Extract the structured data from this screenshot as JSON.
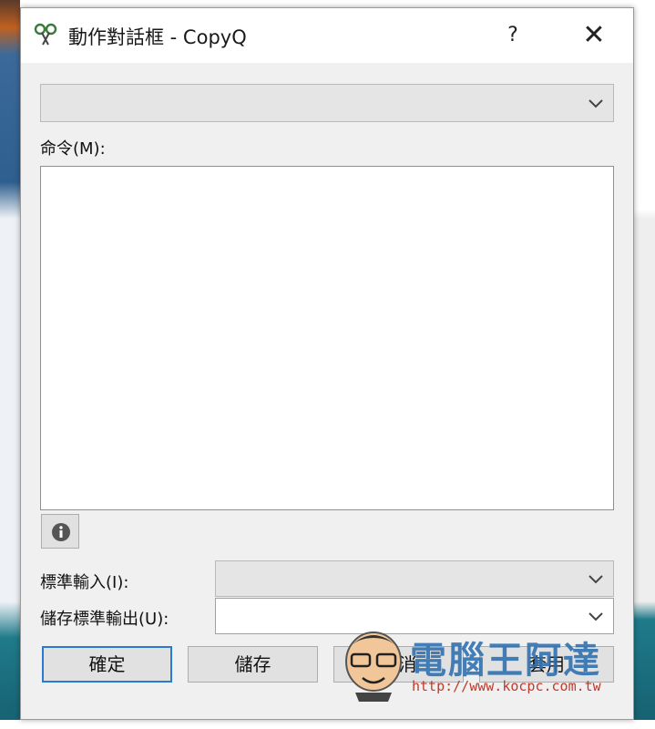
{
  "window": {
    "title": "動作對話框 - CopyQ",
    "help_label": "?",
    "close_label": "✕"
  },
  "action_combo": {
    "value": ""
  },
  "command": {
    "label": "命令(M):",
    "value": ""
  },
  "stdin": {
    "label": "標準輸入(I):",
    "value": ""
  },
  "stdout": {
    "label": "儲存標準輸出(U):",
    "value": ""
  },
  "buttons": {
    "ok": "確定",
    "save": "儲存",
    "cancel": "取消",
    "apply": "套用"
  },
  "watermark": {
    "brand": "電腦王阿達",
    "url": "http://www.kocpc.com.tw"
  },
  "icons": {
    "app": "copyq-scissors-icon",
    "info": "info-icon",
    "dropdown": "chevron-down-icon"
  },
  "colors": {
    "dialog_bg": "#f0f0f0",
    "default_button_border": "#2a7ad4"
  }
}
